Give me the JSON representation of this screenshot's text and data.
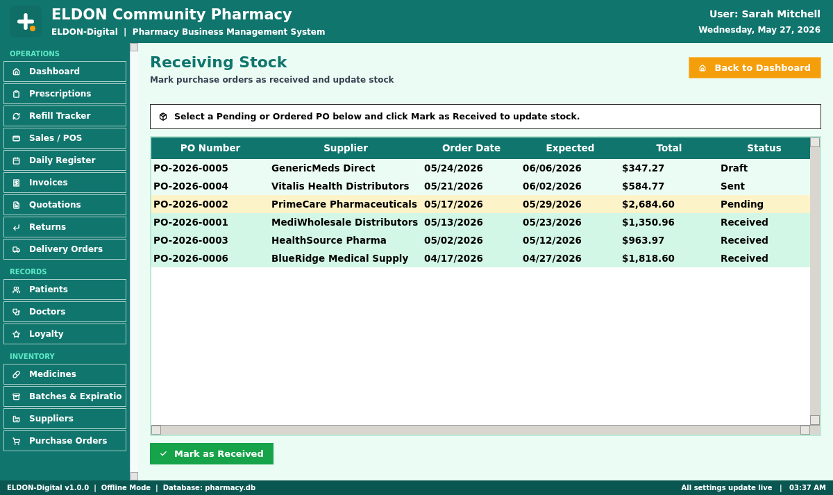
{
  "header": {
    "title": "ELDON Community Pharmacy",
    "subtitle": "ELDON-Digital  |  Pharmacy Business Management System",
    "user": "User: Sarah Mitchell",
    "date": "Wednesday, May 27, 2026"
  },
  "sidebar": {
    "sections": [
      {
        "title": "OPERATIONS",
        "items": [
          {
            "label": "Dashboard"
          },
          {
            "label": "Prescriptions"
          },
          {
            "label": "Refill Tracker"
          },
          {
            "label": "Sales / POS"
          },
          {
            "label": "Daily Register"
          },
          {
            "label": "Invoices"
          },
          {
            "label": "Quotations"
          },
          {
            "label": "Returns"
          },
          {
            "label": "Delivery Orders"
          }
        ]
      },
      {
        "title": "RECORDS",
        "items": [
          {
            "label": "Patients"
          },
          {
            "label": "Doctors"
          },
          {
            "label": "Loyalty"
          }
        ]
      },
      {
        "title": "INVENTORY",
        "items": [
          {
            "label": "Medicines"
          },
          {
            "label": "Batches & Expiratio"
          },
          {
            "label": "Suppliers"
          },
          {
            "label": "Purchase Orders"
          }
        ]
      }
    ]
  },
  "page": {
    "title": "Receiving Stock",
    "subtitle": "Mark purchase orders as received and update stock",
    "back_button": "Back to Dashboard",
    "notice": "Select a Pending or Ordered PO below and click Mark as Received to update stock.",
    "action_button": "Mark as Received"
  },
  "table": {
    "columns": [
      "PO Number",
      "Supplier",
      "Order Date",
      "Expected",
      "Total",
      "Status"
    ],
    "rows": [
      {
        "cells": [
          "PO-2026-0005",
          "GenericMeds Direct",
          "05/24/2026",
          "06/06/2026",
          "$347.27",
          "Draft"
        ],
        "color": "#ebfcf4"
      },
      {
        "cells": [
          "PO-2026-0004",
          "Vitalis Health Distributors",
          "05/21/2026",
          "06/02/2026",
          "$584.77",
          "Sent"
        ],
        "color": "#ebfcf4"
      },
      {
        "cells": [
          "PO-2026-0002",
          "PrimeCare Pharmaceuticals",
          "05/17/2026",
          "05/29/2026",
          "$2,684.60",
          "Pending"
        ],
        "color": "#fdf3c8"
      },
      {
        "cells": [
          "PO-2026-0001",
          "MediWholesale Distributors",
          "05/13/2026",
          "05/23/2026",
          "$1,350.96",
          "Received"
        ],
        "color": "#d3f7e6"
      },
      {
        "cells": [
          "PO-2026-0003",
          "HealthSource Pharma",
          "05/02/2026",
          "05/12/2026",
          "$963.97",
          "Received"
        ],
        "color": "#d3f7e6"
      },
      {
        "cells": [
          "PO-2026-0006",
          "BlueRidge Medical Supply",
          "04/17/2026",
          "04/27/2026",
          "$1,818.60",
          "Received"
        ],
        "color": "#d3f7e6"
      }
    ]
  },
  "status_bar": {
    "left": "ELDON-Digital v1.0.0  |  Offline Mode  |  Database: pharmacy.db",
    "right": "All settings update live   |   03:37 AM"
  }
}
